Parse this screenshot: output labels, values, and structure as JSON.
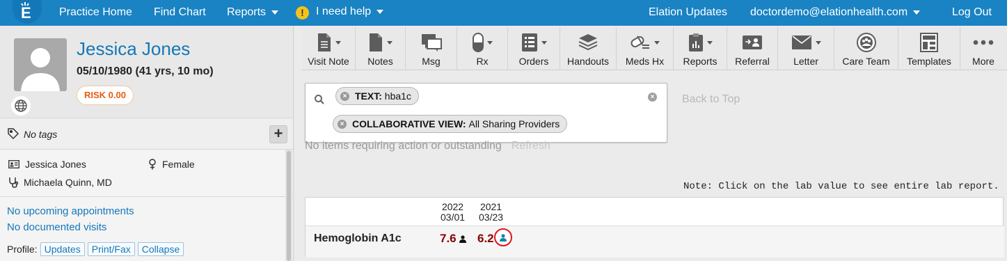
{
  "topnav": {
    "items": [
      "Practice Home",
      "Find Chart",
      "Reports",
      "I need help"
    ],
    "right": [
      "Elation Updates",
      "doctordemo@elationhealth.com",
      "Log Out"
    ]
  },
  "patient": {
    "name": "Jessica Jones",
    "dob": "05/10/1980 (41 yrs, 10 mo)",
    "risk": "RISK 0.00",
    "tags": "No tags",
    "display_name": "Jessica Jones",
    "sex": "Female",
    "provider": "Michaela Quinn, MD",
    "appointments": "No upcoming appointments",
    "visits": "No documented visits",
    "profile_label": "Profile:",
    "profile_buttons": [
      "Updates",
      "Print/Fax",
      "Collapse"
    ]
  },
  "toolbar": [
    "Visit Note",
    "Notes",
    "Msg",
    "Rx",
    "Orders",
    "Handouts",
    "Meds Hx",
    "Reports",
    "Referral",
    "Letter",
    "Care Team",
    "Templates",
    "More"
  ],
  "search": {
    "chips": [
      {
        "label": "TEXT:",
        "value": "hba1c"
      },
      {
        "label": "COLLABORATIVE VIEW:",
        "value": "All Sharing Providers"
      }
    ]
  },
  "back_to_top": "Back to Top",
  "outstanding": {
    "text": "No items requiring action or outstanding",
    "refresh": "Refresh"
  },
  "note": "Note: Click on the lab value to see entire lab report.",
  "labs": {
    "dates": [
      {
        "year": "2022",
        "md": "03/01"
      },
      {
        "year": "2021",
        "md": "03/23"
      }
    ],
    "rows": [
      {
        "name": "Hemoglobin A1c",
        "values": [
          "7.6",
          "6.2"
        ]
      }
    ]
  },
  "colors": {
    "nav": "#1983c3",
    "link": "#1478b8",
    "lab_value": "#8b0000",
    "risk": "#e45d10",
    "highlight_ring": "#e0151b"
  }
}
